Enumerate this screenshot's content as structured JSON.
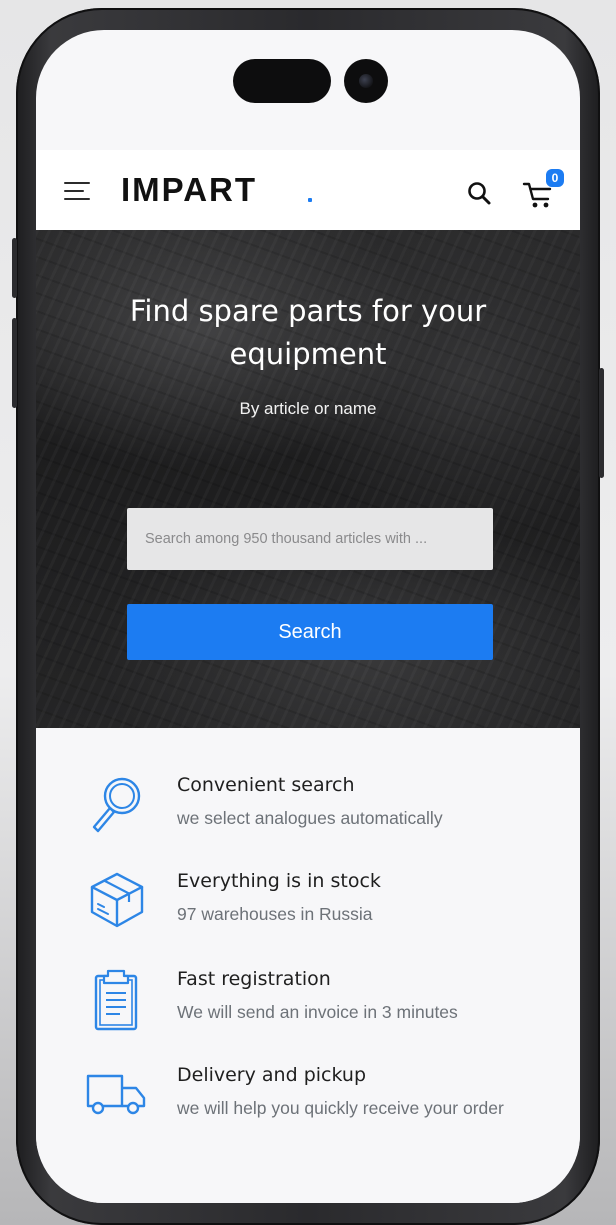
{
  "header": {
    "logo": "IMPART",
    "cart_count": "0"
  },
  "hero": {
    "title": "Find spare parts for your equipment",
    "subtitle": "By article or name",
    "search_placeholder": "Search among 950 thousand articles with ...",
    "search_button_label": "Search"
  },
  "features": [
    {
      "icon": "magnifier-icon",
      "title": "Convenient search",
      "description": "we select analogues automatically"
    },
    {
      "icon": "box-icon",
      "title": "Everything is in stock",
      "description": "97 warehouses in Russia"
    },
    {
      "icon": "clipboard-icon",
      "title": "Fast registration",
      "description": "We will send an invoice in 3 minutes"
    },
    {
      "icon": "truck-icon",
      "title": "Delivery and pickup",
      "description": "we will help you quickly receive your order"
    }
  ],
  "colors": {
    "accent": "#1c7cf2",
    "icon_stroke": "#2d86e6",
    "header_bg": "#ffffff",
    "hero_bg": "#222223",
    "text_primary": "#1f1f1f",
    "text_secondary": "#6d7278"
  }
}
